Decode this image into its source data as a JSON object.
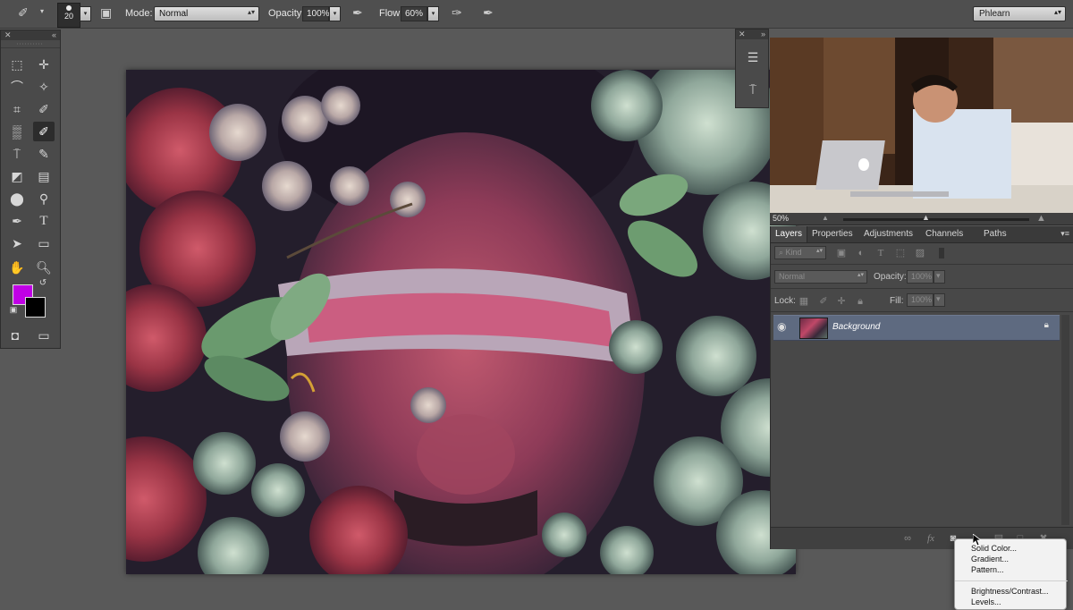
{
  "options_bar": {
    "brush_size": "20",
    "mode_label": "Mode:",
    "mode_value": "Normal",
    "opacity_label": "Opacity:",
    "opacity_value": "100%",
    "flow_label": "Flow:",
    "flow_value": "60%",
    "workspace_value": "Phlearn"
  },
  "colors": {
    "foreground": "#c000e6",
    "background": "#000000",
    "selected_layer": "#5e6a80"
  },
  "navigator": {
    "zoom": "50%"
  },
  "panel_tabs": [
    {
      "label": "Layers",
      "active": true
    },
    {
      "label": "Properties",
      "active": false
    },
    {
      "label": "Adjustments",
      "active": false
    },
    {
      "label": "Channels",
      "active": false
    },
    {
      "label": "Paths",
      "active": false
    }
  ],
  "layers_panel": {
    "filter_kind": "Kind",
    "blend_mode": "Normal",
    "opacity_label": "Opacity:",
    "opacity_value": "100%",
    "lock_label": "Lock:",
    "fill_label": "Fill:",
    "fill_value": "100%",
    "layers": [
      {
        "name": "Background",
        "visible": true,
        "locked": true,
        "selected": true
      }
    ]
  },
  "adjustment_menu": {
    "items": [
      "Solid Color...",
      "Gradient...",
      "Pattern...",
      "Brightness/Contrast...",
      "Levels..."
    ]
  }
}
